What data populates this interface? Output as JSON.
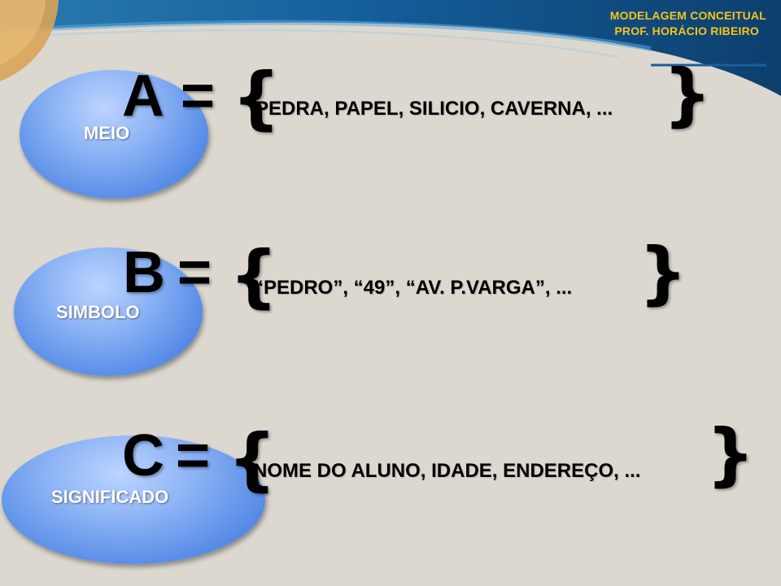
{
  "header": {
    "course": "MODELAGEM CONCEITUAL",
    "professor": "PROF. HORÁCIO RIBEIRO"
  },
  "rows": [
    {
      "concept": "MEIO",
      "variable": "A",
      "equals": "=",
      "open_brace": "{",
      "set_items": "PEDRA, PAPEL, SILICIO, CAVERNA, ...",
      "close_brace": "}"
    },
    {
      "concept": "SIMBOLO",
      "variable": "B",
      "equals": "=",
      "open_brace": "{",
      "set_items": "“PEDRO”,  “49”,  “AV. P.VARGA”,  ...",
      "close_brace": "}"
    },
    {
      "concept": "SIGNIFICADO",
      "variable": "C",
      "equals": "=",
      "open_brace": "{",
      "set_items": "NOME DO ALUNO, IDADE, ENDEREÇO, ...",
      "close_brace": "}"
    }
  ],
  "colors": {
    "header_text": "#f5c518",
    "header_blue": "#0f4e85",
    "ellipse_blue": "#5b8fe8",
    "background": "#dcd8d0"
  }
}
